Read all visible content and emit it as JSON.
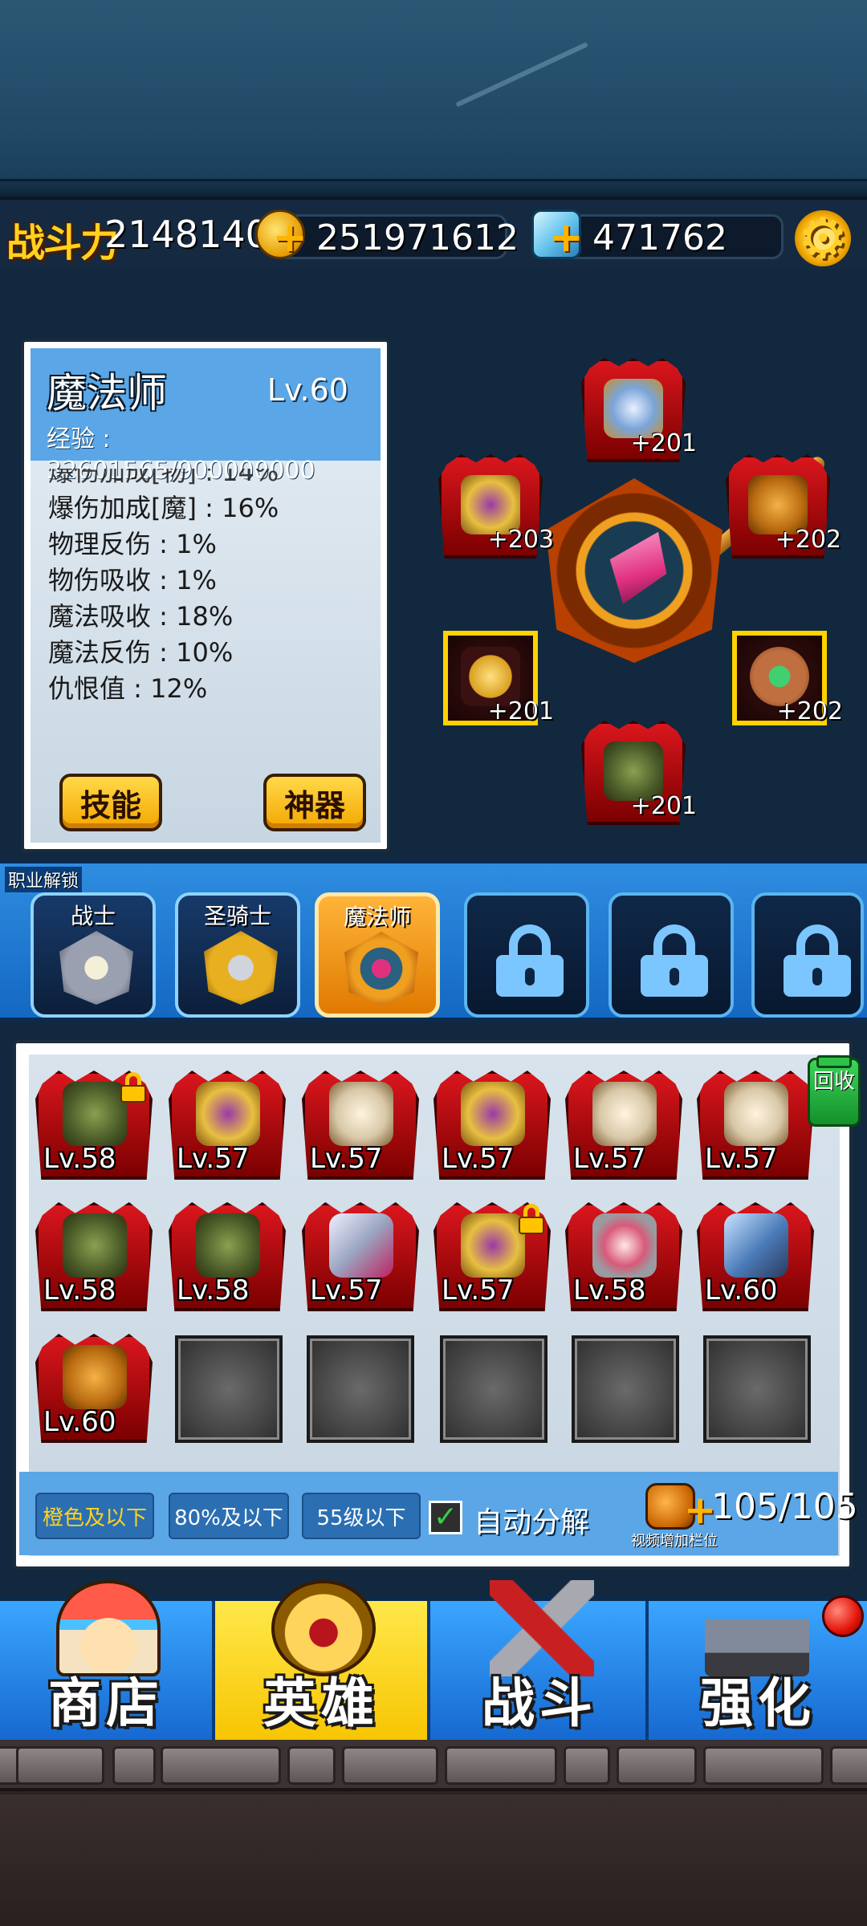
{
  "status": {
    "power_label": "战斗力",
    "power_value": "2148140",
    "coins": "251971612",
    "gems": "471762",
    "coin_icon": "gold-coin-icon",
    "gem_icon": "diamond-icon",
    "settings_icon": "gear-icon"
  },
  "hero": {
    "name": "魔法师",
    "level": "Lv.60",
    "exp": "经验 : 32601565/900000000",
    "stats": [
      "爆伤加成[物] : 14%",
      "爆伤加成[魔] : 16%",
      "物理反伤 : 1%",
      "物伤吸收 : 1%",
      "魔法吸收 : 18%",
      "魔法反伤 : 10%",
      "仇恨值 : 12%"
    ],
    "skill_button": "技能",
    "artifact_button": "神器"
  },
  "equipped": {
    "helmet_bonus": "+201",
    "armor_bonus": "+203",
    "weapon_bonus": "+202",
    "amulet_bonus": "+201",
    "ring_bonus": "+202",
    "boots_bonus": "+201"
  },
  "classes": {
    "section_label": "职业解锁",
    "items": [
      {
        "name": "战士",
        "locked": false
      },
      {
        "name": "圣骑士",
        "locked": false
      },
      {
        "name": "魔法师",
        "locked": false,
        "active": true
      },
      {
        "name": "",
        "locked": true
      },
      {
        "name": "",
        "locked": true
      },
      {
        "name": "",
        "locked": true
      }
    ]
  },
  "inventory": {
    "recycle_button": "回收",
    "rows": [
      [
        "Lv.58",
        "Lv.57",
        "Lv.57",
        "Lv.57",
        "Lv.57",
        "Lv.57"
      ],
      [
        "Lv.58",
        "Lv.58",
        "Lv.57",
        "Lv.57",
        "Lv.58",
        "Lv.60"
      ],
      [
        "Lv.60"
      ]
    ],
    "filters": [
      "橙色及以下",
      "80%及以下",
      "55级以下"
    ],
    "auto_decompose_label": "自动分解",
    "auto_decompose_checked": true,
    "slot_count": "105/105",
    "video_hint": "视频增加栏位"
  },
  "nav": {
    "shop": "商店",
    "hero": "英雄",
    "battle": "战斗",
    "forge": "强化",
    "active": "hero"
  },
  "colors": {
    "accent_gold": "#ffd21f",
    "panel_blue": "#5aa6e6",
    "item_red": "#d9161d",
    "nav_active": "#f7c400"
  }
}
